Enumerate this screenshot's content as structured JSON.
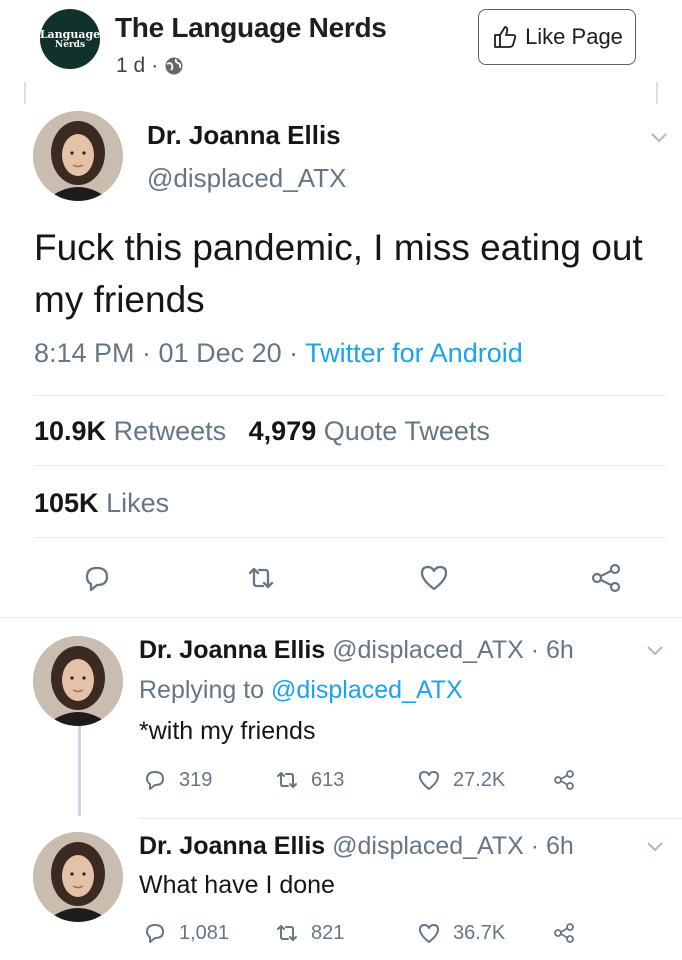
{
  "facebook_post": {
    "page_logo_text": [
      "Language",
      "Nerds"
    ],
    "page_name": "The Language Nerds",
    "time_ago": "1 d",
    "separator": "·",
    "like_page_label": "Like Page"
  },
  "tweet": {
    "author_name": "Dr. Joanna Ellis",
    "author_handle": "@displaced_ATX",
    "text": "Fuck this pandemic, I miss eating out my friends",
    "time": "8:14 PM · 01 Dec 20 · ",
    "source": "Twitter for Android",
    "retweets_count": "10.9K",
    "retweets_label": "Retweets",
    "quote_tweets_count": "4,979",
    "quote_tweets_label": "Quote Tweets",
    "likes_count": "105K",
    "likes_label": "Likes"
  },
  "replies": [
    {
      "author_name": "Dr. Joanna Ellis",
      "author_handle": "@displaced_ATX · 6h",
      "replying_prefix": "Replying to ",
      "replying_to": "@displaced_ATX",
      "text": "*with my friends",
      "replies": "319",
      "retweets": "613",
      "likes": "27.2K"
    },
    {
      "author_name": "Dr. Joanna Ellis",
      "author_handle": "@displaced_ATX · 6h",
      "text": "What have I done",
      "replies": "1,081",
      "retweets": "821",
      "likes": "36.7K"
    }
  ],
  "icons": [
    "globe-icon",
    "thumbs-up-icon",
    "chevron-down-icon",
    "reply-icon",
    "retweet-icon",
    "heart-icon",
    "share-icon"
  ],
  "colors": {
    "twitter_blue": "#1da1f2",
    "secondary_gray": "#657786",
    "logo_green": "#10322a"
  }
}
